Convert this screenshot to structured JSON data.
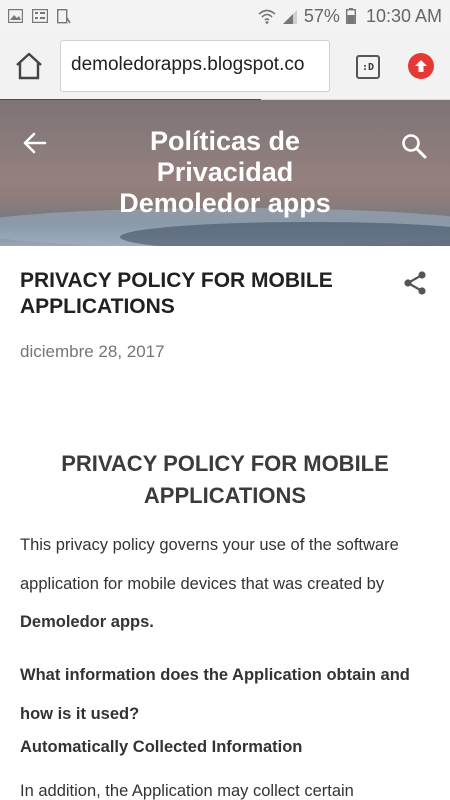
{
  "status_bar": {
    "battery_percent": "57%",
    "time": "10:30 AM",
    "icons": [
      "image-icon",
      "checklist-icon",
      "phone-tablet-icon",
      "wifi-icon",
      "signal-icon",
      "battery-icon"
    ]
  },
  "browser": {
    "url": "demoledorapps.blogspot.co",
    "tabs_label": ":D",
    "home_icon": "home-icon",
    "menu_icon": "arrow-up-badge-icon",
    "load_progress": 0.58
  },
  "header": {
    "title_lines": [
      "Políticas de",
      "Privacidad",
      "Demoledor apps"
    ],
    "back_icon": "back-arrow-icon",
    "search_icon": "search-icon"
  },
  "post": {
    "title": "PRIVACY POLICY FOR MOBILE APPLICATIONS",
    "date": "diciembre 28, 2017",
    "share_icon": "share-icon",
    "heading": "PRIVACY POLICY FOR MOBILE APPLICATIONS",
    "intro_text": "This privacy policy governs your use of the software application for mobile devices that was created by",
    "intro_bold": "Demoledor apps.",
    "question": "What information does the Application obtain and how is it used?",
    "subheading": "Automatically Collected Information",
    "paragraph_start": "In addition, the Application may collect certain"
  },
  "colors": {
    "menu_badge": "#e53935",
    "text": "#212121",
    "date": "#757575"
  }
}
